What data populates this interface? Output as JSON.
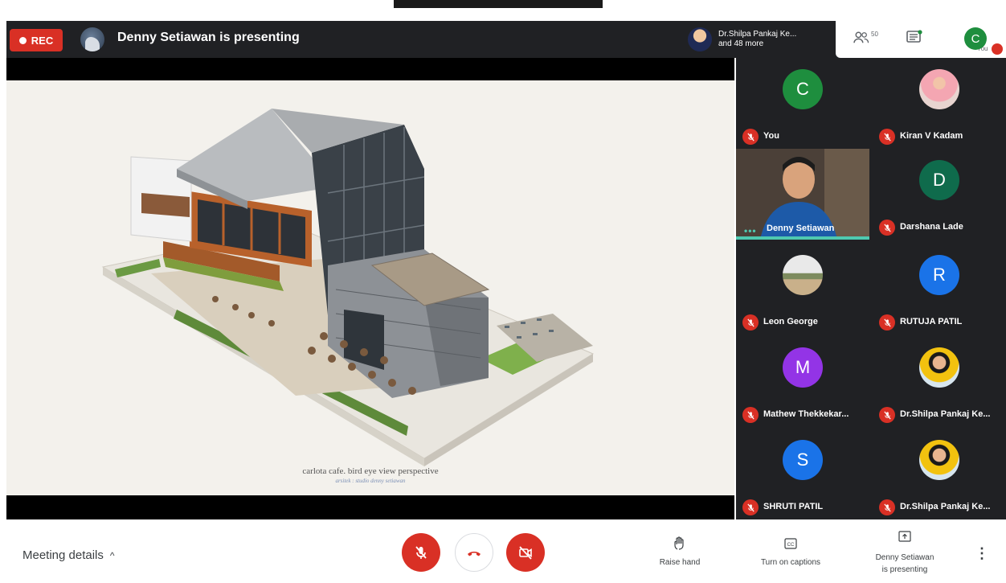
{
  "top_bar": {
    "rec_label": "REC",
    "presenter_text": "Denny Setiawan is presenting",
    "others": {
      "line1": "Dr.Shilpa Pankaj Ke...",
      "line2": "and 48 more"
    },
    "people_count": "50",
    "self_initial": "C",
    "self_label": "You"
  },
  "presentation": {
    "caption": "carlota cafe. bird eye view perspective",
    "caption_sub": "arsitek : studio denny setiawan"
  },
  "participants": [
    {
      "name": "You",
      "initial": "C",
      "color": "#1e8e3e",
      "type": "initial"
    },
    {
      "name": "Kiran V Kadam",
      "type": "photo",
      "icon": "person-photo"
    },
    {
      "name": "Denny Setiawan",
      "type": "video",
      "speaking": "•••"
    },
    {
      "name": "Darshana Lade",
      "initial": "D",
      "color": "#0f6b4c",
      "type": "initial"
    },
    {
      "name": "Leon George",
      "type": "photo",
      "icon": "landscape-photo"
    },
    {
      "name": "RUTUJA PATIL",
      "initial": "R",
      "color": "#1a73e8",
      "type": "initial"
    },
    {
      "name": "Mathew Thekkekar...",
      "initial": "M",
      "color": "#9334e6",
      "type": "initial"
    },
    {
      "name": "Dr.Shilpa Pankaj Ke...",
      "type": "photo",
      "icon": "person-photo"
    },
    {
      "name": "SHRUTI PATIL",
      "initial": "S",
      "color": "#1a73e8",
      "type": "initial"
    },
    {
      "name": "Dr.Shilpa Pankaj Ke...",
      "type": "photo",
      "icon": "person-photo"
    }
  ],
  "bottom_bar": {
    "meeting_details": "Meeting details",
    "raise_hand": "Raise hand",
    "captions": "Turn on captions",
    "present_line1": "Denny Setiawan",
    "present_line2": "is presenting"
  },
  "colors": {
    "danger": "#d93025",
    "speaking": "#4ec9b0",
    "dark_bg": "#202124"
  }
}
